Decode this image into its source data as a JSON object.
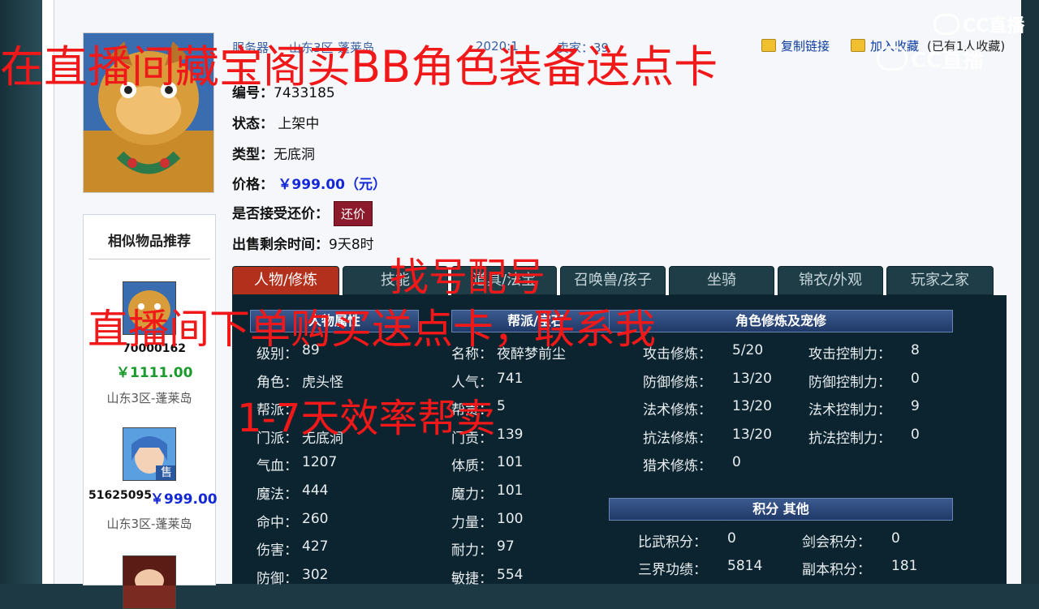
{
  "overlay": {
    "line1": "在直播间藏宝阁买BB角色装备送点卡",
    "line2": "找号配号",
    "line3": "直播间下单购买送点卡，联系我",
    "line4": "1-7天效率帮卖"
  },
  "watermark": {
    "brand": "CC直播"
  },
  "info_bar": {
    "server_label": "服务器",
    "server_value": "山东3区-蓬莱岛",
    "date_fragment": "2020:1",
    "seller_fragment": "卖家：39"
  },
  "actions": {
    "copy_link": "复制链接",
    "favorite": "加入收藏",
    "collected": "(已有1人收藏)"
  },
  "item": {
    "id_label": "编号：",
    "id_value": "7433185",
    "status_label": "状态：",
    "status_value": "上架中",
    "type_label": "类型：",
    "type_value": "无底洞",
    "price_label": "价格：",
    "price_value": "￥999.00（元）",
    "bargain_label": "是否接受还价：",
    "bargain_button": "还价",
    "remaining_label": "出售剩余时间：",
    "remaining_value": "9天8时"
  },
  "recommend": {
    "title": "相似物品推荐",
    "items": [
      {
        "id": "70000162",
        "price": "￥1111.00",
        "server": "山东3区-蓬莱岛"
      },
      {
        "id": "51625095",
        "price": "￥999.00",
        "server": "山东3区-蓬莱岛",
        "badge": "售"
      }
    ]
  },
  "tabs": [
    "人物/修炼",
    "技能",
    "道具/法宝",
    "召唤兽/孩子",
    "坐骑",
    "锦衣/外观",
    "玩家之家"
  ],
  "panel": {
    "hdr_left": "人物属性",
    "hdr_mid": "帮派/宝石",
    "hdr_right": "角色修炼及宠修",
    "hdr_score": "积分 其他",
    "col1": [
      {
        "label": "级别：",
        "value": "89"
      },
      {
        "label": "角色：",
        "value": "虎头怪"
      },
      {
        "label": "帮派：",
        "value": ""
      },
      {
        "label": "门派：",
        "value": "无底洞"
      },
      {
        "label": "气血：",
        "value": "1207"
      },
      {
        "label": "魔法：",
        "value": "444"
      },
      {
        "label": "命中：",
        "value": "260"
      },
      {
        "label": "伤害：",
        "value": "427"
      },
      {
        "label": "防御：",
        "value": "302"
      }
    ],
    "col2": [
      {
        "label": "名称：",
        "value": "夜醉梦前尘"
      },
      {
        "label": "人气：",
        "value": "741"
      },
      {
        "label": "帮贡：",
        "value": "5"
      },
      {
        "label": "门贡：",
        "value": "139"
      },
      {
        "label": "体质：",
        "value": "101"
      },
      {
        "label": "魔力：",
        "value": "101"
      },
      {
        "label": "力量：",
        "value": "100"
      },
      {
        "label": "耐力：",
        "value": "97"
      },
      {
        "label": "敏捷：",
        "value": "554"
      }
    ],
    "col3": [
      {
        "label": "攻击修炼：",
        "value": "5/20"
      },
      {
        "label": "防御修炼：",
        "value": "13/20"
      },
      {
        "label": "法术修炼：",
        "value": "13/20"
      },
      {
        "label": "抗法修炼：",
        "value": "13/20"
      },
      {
        "label": "猎术修炼：",
        "value": "0"
      }
    ],
    "col4": [
      {
        "label": "攻击控制力：",
        "value": "8"
      },
      {
        "label": "防御控制力：",
        "value": "0"
      },
      {
        "label": "法术控制力：",
        "value": "9"
      },
      {
        "label": "抗法控制力：",
        "value": "0"
      }
    ],
    "score": [
      {
        "label": "比武积分：",
        "value": "0"
      },
      {
        "label": "剑会积分：",
        "value": "0"
      },
      {
        "label": "三界功绩：",
        "value": "5814"
      },
      {
        "label": "副本积分：",
        "value": "181"
      }
    ]
  }
}
